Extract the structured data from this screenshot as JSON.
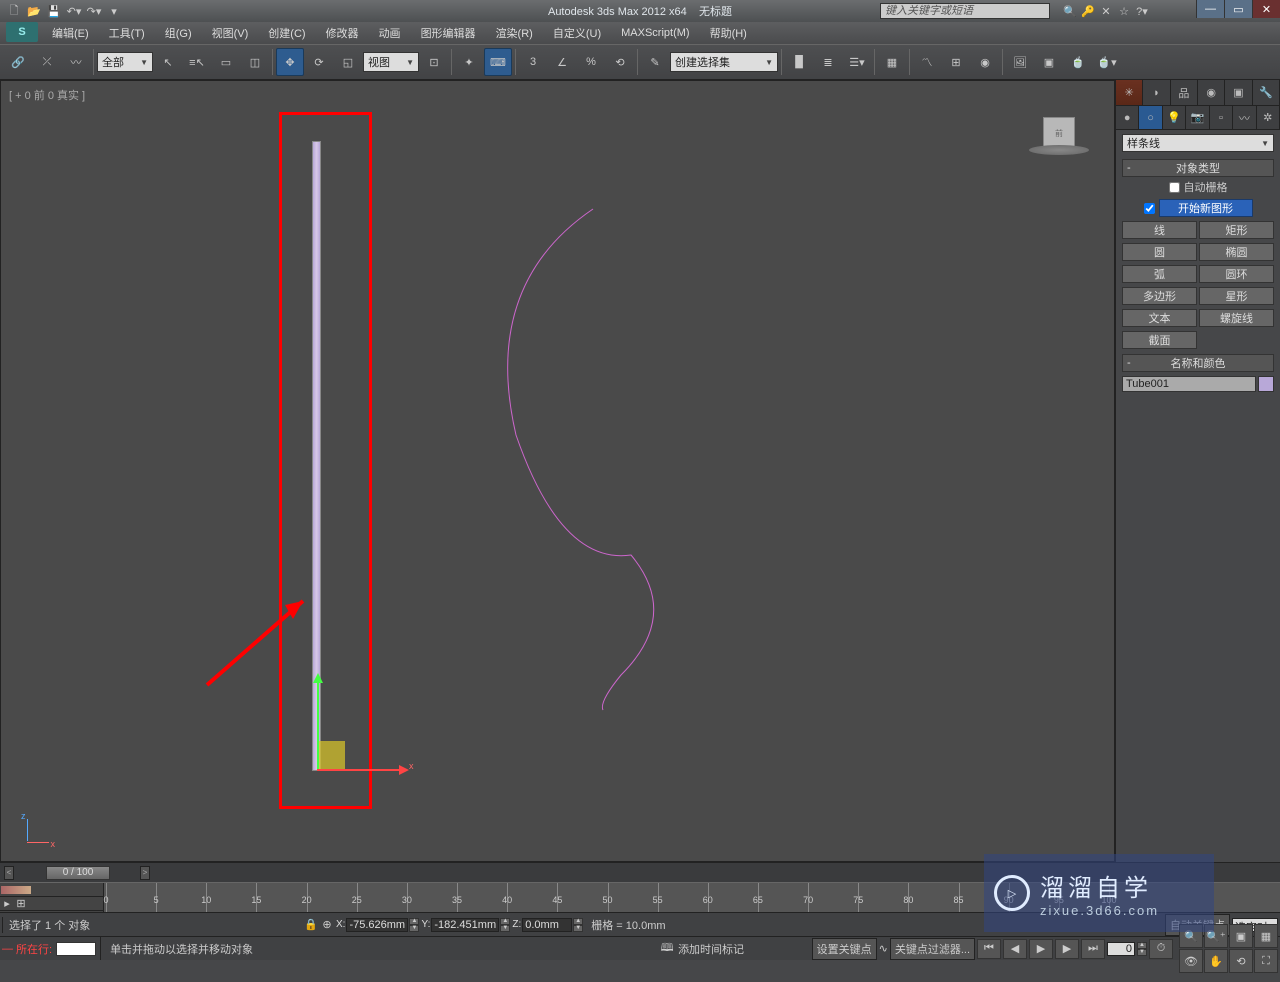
{
  "titlebar": {
    "app_name": "Autodesk 3ds Max 2012 x64",
    "doc_title": "无标题",
    "search_placeholder": "键入关键字或短语",
    "qat": [
      "📄",
      "📂",
      "💾",
      "↶",
      "↷",
      "⟳"
    ]
  },
  "menubar": {
    "items": [
      "编辑(E)",
      "工具(T)",
      "组(G)",
      "视图(V)",
      "创建(C)",
      "修改器",
      "动画",
      "图形编辑器",
      "渲染(R)",
      "自定义(U)",
      "MAXScript(M)",
      "帮助(H)"
    ]
  },
  "toolbar": {
    "filter_dd": "全部",
    "refsys_dd": "视图",
    "named_sel_dd": "创建选择集"
  },
  "viewport": {
    "label": "[ + 0  前  0 真实 ]",
    "axis_z": "z",
    "axis_x": "x"
  },
  "cmd_panel": {
    "category_dd": "样条线",
    "rollouts": {
      "object_type": "对象类型",
      "auto_grid": "自动栅格",
      "start_shape": "开始新图形",
      "name_color": "名称和颜色"
    },
    "buttons": {
      "line": "线",
      "rectangle": "矩形",
      "circle": "圆",
      "ellipse": "椭圆",
      "arc": "弧",
      "donut": "圆环",
      "ngon": "多边形",
      "star": "星形",
      "text": "文本",
      "helix": "螺旋线",
      "section": "截面"
    },
    "object_name": "Tube001"
  },
  "timeline": {
    "slider": "0 / 100",
    "ticks": [
      0,
      5,
      10,
      15,
      20,
      25,
      30,
      35,
      40,
      45,
      50,
      55,
      60,
      65,
      70,
      75,
      80,
      85,
      90,
      95,
      100
    ]
  },
  "status": {
    "selection": "选择了 1 个 对象",
    "prompt": "单击并拖动以选择并移动对象",
    "script_label": "所在行:",
    "x_label": "X:",
    "x_val": "-75.626mm",
    "y_label": "Y:",
    "y_val": "-182.451mm",
    "z_label": "Z:",
    "z_val": "0.0mm",
    "grid": "栅格 = 10.0mm",
    "add_time_tag": "添加时间标记",
    "auto_key": "自动关键点",
    "selected_dd": "选定对",
    "set_key": "设置关键点",
    "key_filters": "关键点过滤器...",
    "frame_val": "0"
  },
  "watermark": {
    "line1": "溜溜自学",
    "line2": "zixue.3d66.com"
  }
}
